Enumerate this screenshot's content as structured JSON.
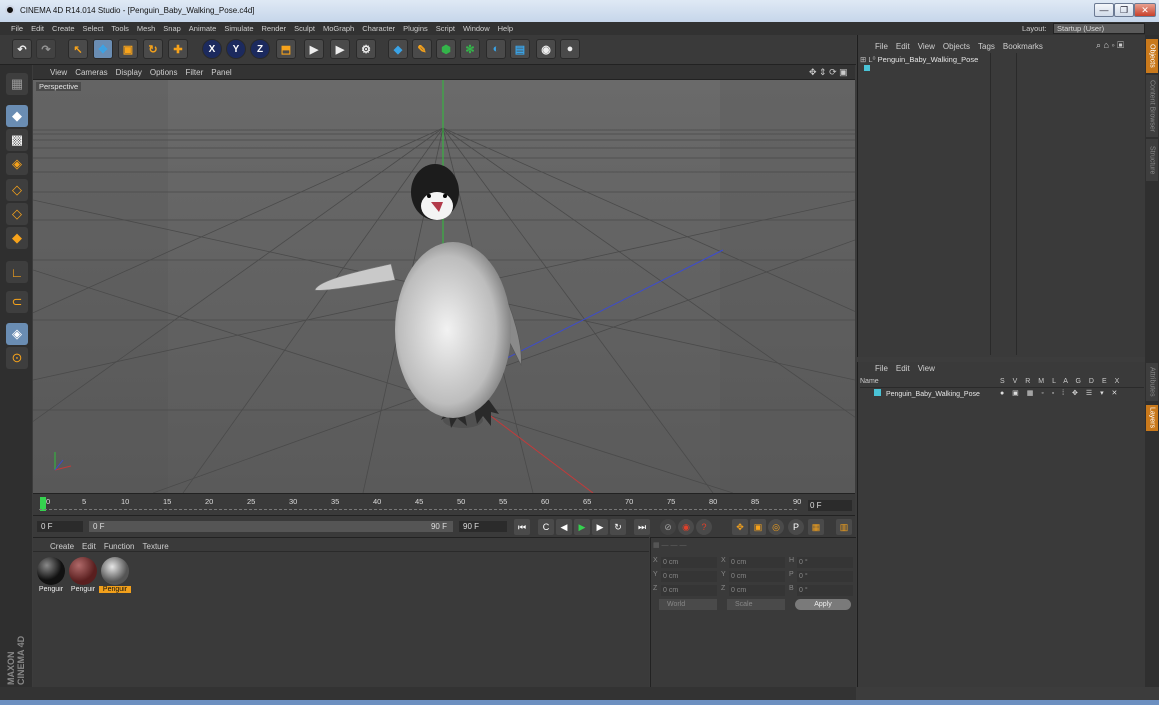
{
  "window": {
    "title": "CINEMA 4D R14.014 Studio - [Penguin_Baby_Walking_Pose.c4d]",
    "buttons": [
      "—",
      "❐",
      "✕"
    ]
  },
  "menubar": {
    "items": [
      "File",
      "Edit",
      "Create",
      "Select",
      "Tools",
      "Mesh",
      "Snap",
      "Animate",
      "Simulate",
      "Render",
      "Sculpt",
      "MoGraph",
      "Character",
      "Plugins",
      "Script",
      "Window",
      "Help"
    ],
    "layout_label": "Layout:",
    "layout_value": "Startup (User)"
  },
  "viewport": {
    "menu": [
      "View",
      "Cameras",
      "Display",
      "Options",
      "Filter",
      "Panel"
    ],
    "label": "Perspective"
  },
  "timeline": {
    "ticks": [
      "0",
      "5",
      "10",
      "15",
      "20",
      "25",
      "30",
      "35",
      "40",
      "45",
      "50",
      "55",
      "60",
      "65",
      "70",
      "75",
      "80",
      "85",
      "90"
    ],
    "current_frame": "0 F"
  },
  "transport": {
    "start": "0 F",
    "range_start": "0 F",
    "range_end": "90 F",
    "end": "90 F"
  },
  "materials": {
    "menu": [
      "Create",
      "Edit",
      "Function",
      "Texture"
    ],
    "items": [
      {
        "label": "Penguir",
        "color": "#111111",
        "selected": false
      },
      {
        "label": "Penguir",
        "color": "#6e2a2a",
        "selected": false
      },
      {
        "label": "Penguir",
        "color": "#8a8a8a",
        "selected": true
      }
    ]
  },
  "coordinates": {
    "rows": [
      {
        "a": "X",
        "av": "0 cm",
        "b": "X",
        "bv": "0 cm",
        "c": "H",
        "cv": "0 °"
      },
      {
        "a": "Y",
        "av": "0 cm",
        "b": "Y",
        "bv": "0 cm",
        "c": "P",
        "cv": "0 °"
      },
      {
        "a": "Z",
        "av": "0 cm",
        "b": "Z",
        "bv": "0 cm",
        "c": "B",
        "cv": "0 °"
      }
    ],
    "world": "World",
    "scale": "Scale",
    "apply": "Apply"
  },
  "objects": {
    "menu": [
      "File",
      "Edit",
      "View",
      "Objects",
      "Tags",
      "Bookmarks"
    ],
    "item": "Penguin_Baby_Walking_Pose"
  },
  "layers": {
    "menu": [
      "File",
      "Edit",
      "View"
    ],
    "name_header": "Name",
    "flags": [
      "S",
      "V",
      "R",
      "M",
      "L",
      "A",
      "G",
      "D",
      "E",
      "X"
    ],
    "item": "Penguin_Baby_Walking_Pose"
  },
  "right_tabs": [
    "Objects",
    "Content Browser",
    "Structure",
    "Attributes",
    "Layers"
  ],
  "brand": "MAXON CINEMA 4D",
  "colors": {
    "accent": "#f2a01b",
    "selection": "#4ac3d6"
  }
}
